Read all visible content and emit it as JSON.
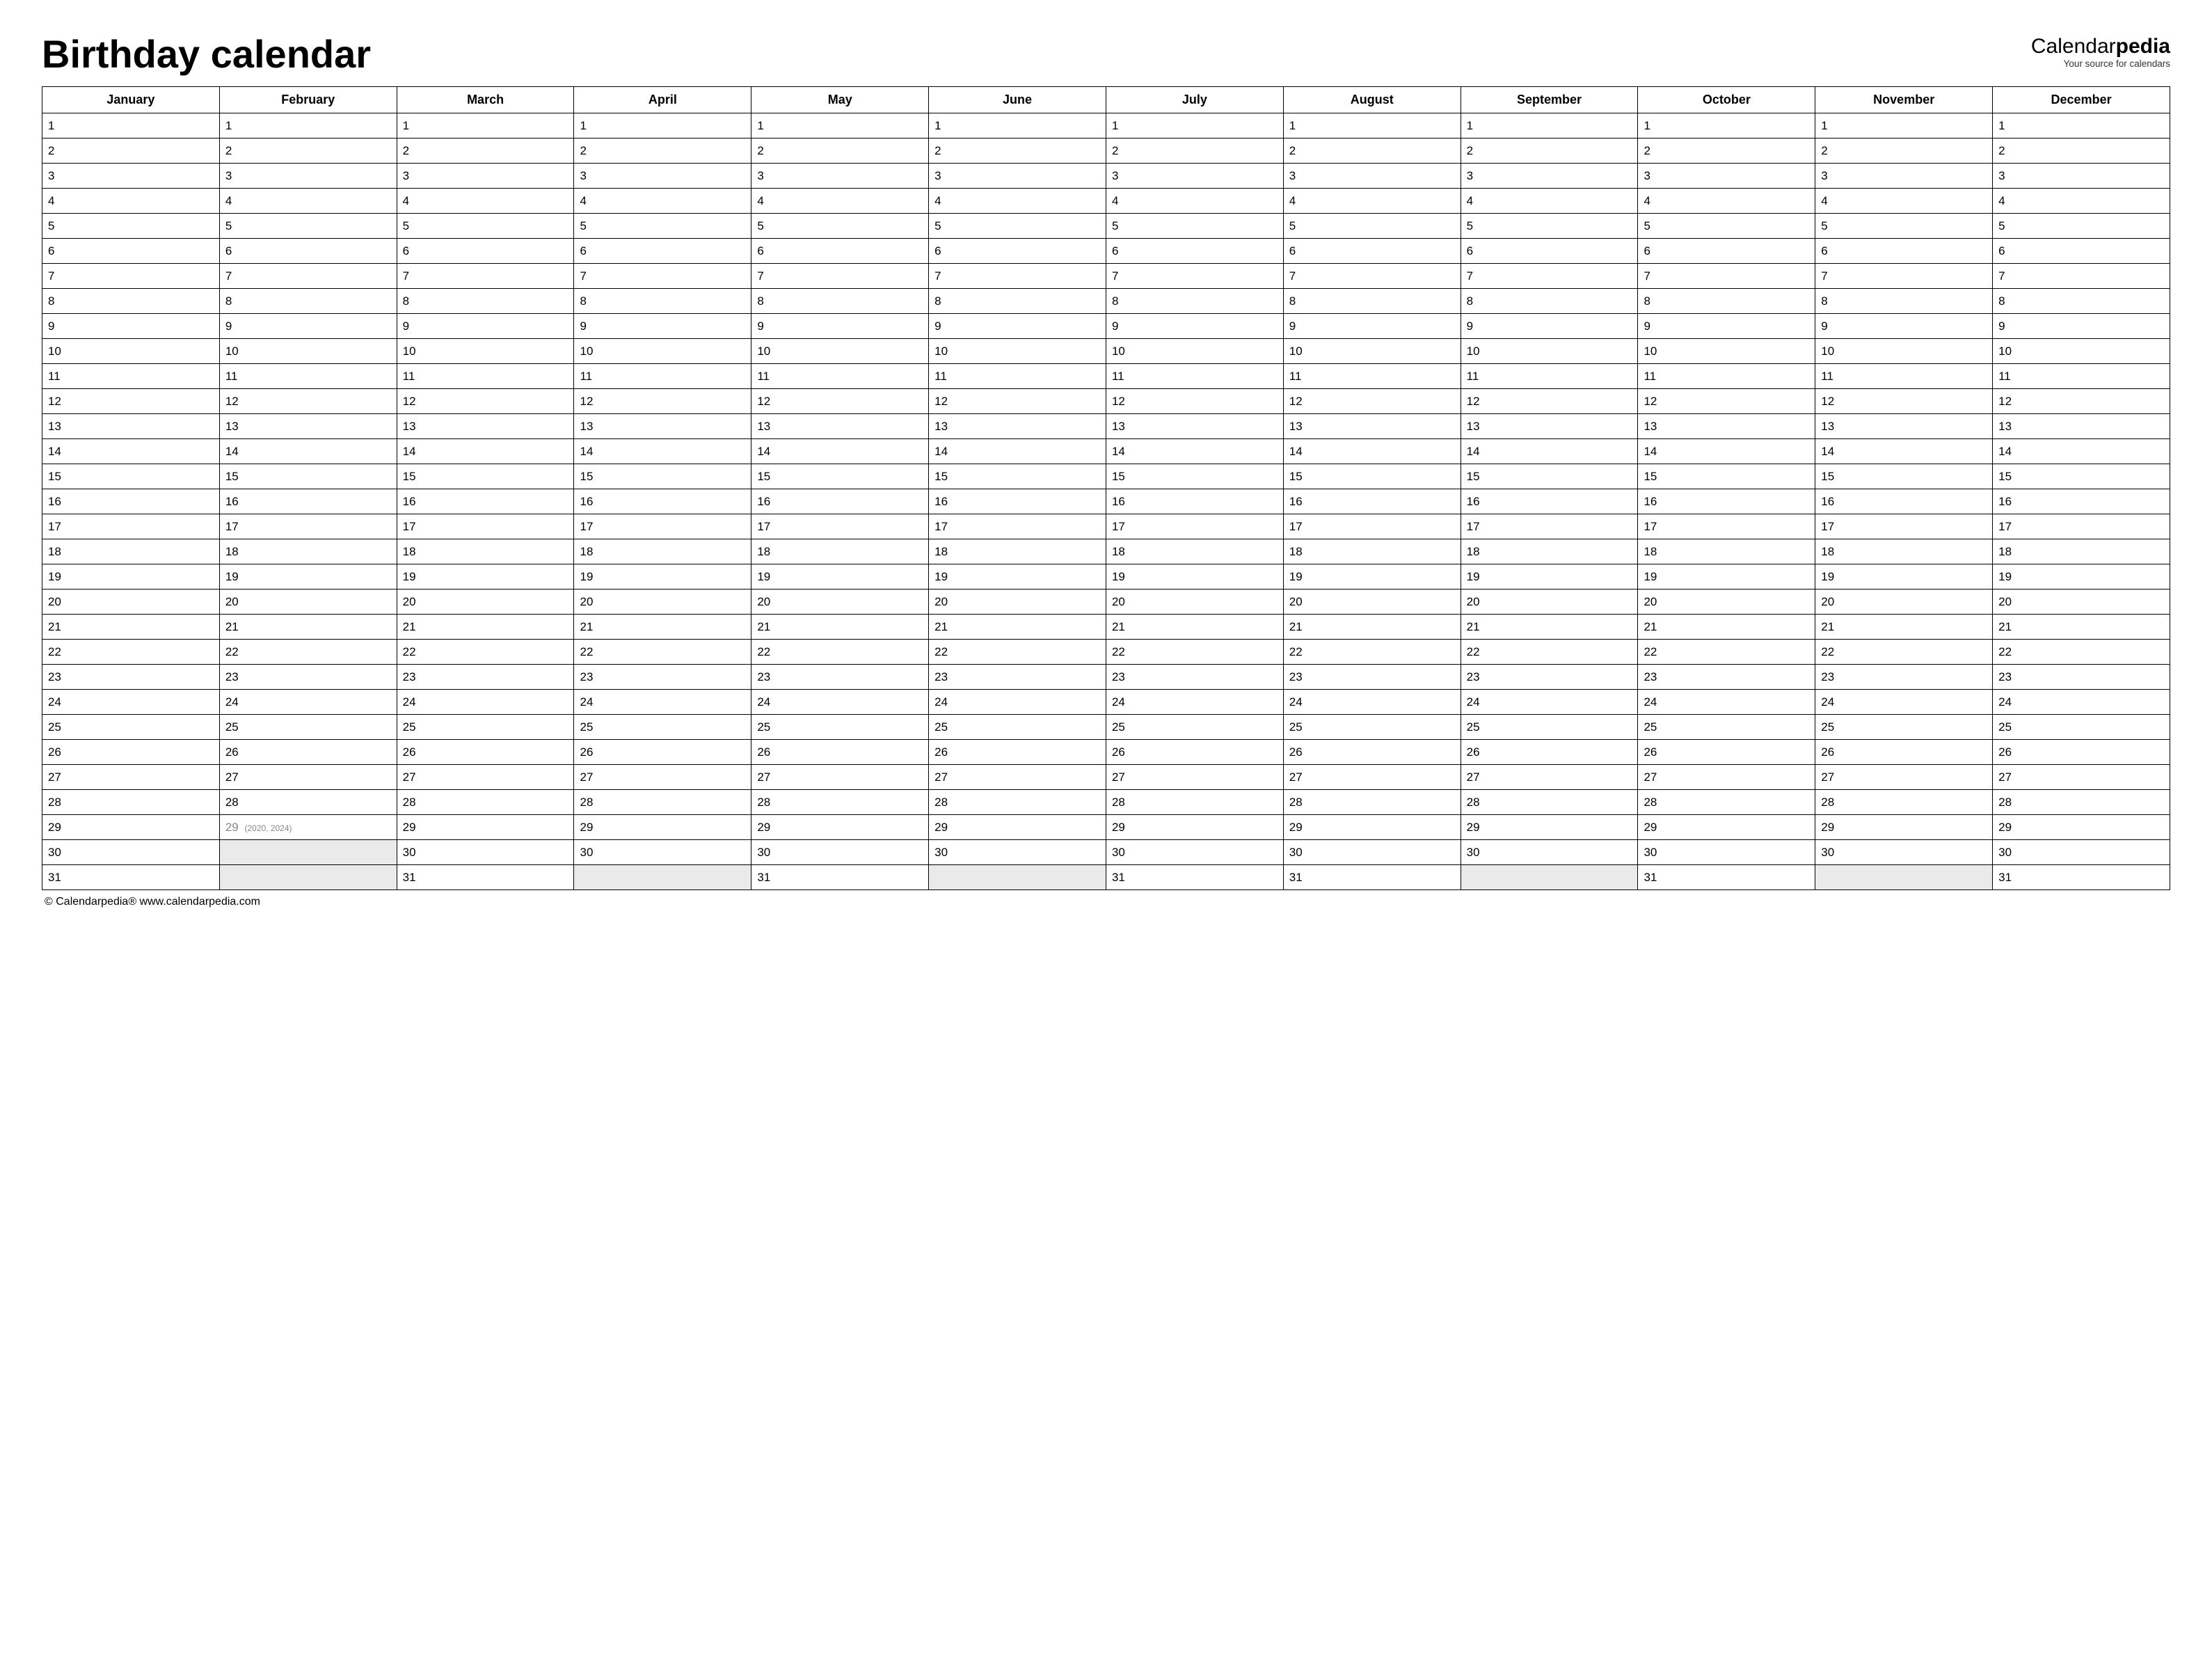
{
  "title": "Birthday calendar",
  "brand": {
    "prefix": "Calendar",
    "suffix": "pedia",
    "tagline": "Your source for calendars"
  },
  "months": [
    {
      "name": "January",
      "days": 31
    },
    {
      "name": "February",
      "days": 29,
      "note_day": 29,
      "note": "(2020, 2024)"
    },
    {
      "name": "March",
      "days": 31
    },
    {
      "name": "April",
      "days": 30
    },
    {
      "name": "May",
      "days": 31
    },
    {
      "name": "June",
      "days": 30
    },
    {
      "name": "July",
      "days": 31
    },
    {
      "name": "August",
      "days": 31
    },
    {
      "name": "September",
      "days": 30
    },
    {
      "name": "October",
      "days": 31
    },
    {
      "name": "November",
      "days": 30
    },
    {
      "name": "December",
      "days": 31
    }
  ],
  "max_days": 31,
  "footer": {
    "copyright": "© Calendarpedia®   www.calendarpedia.com"
  }
}
